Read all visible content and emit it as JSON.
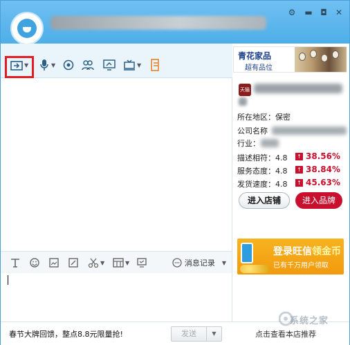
{
  "window": {
    "controls": [
      "⚙",
      "▬",
      "◘",
      "✕"
    ]
  },
  "toolbar": {
    "buttons": [
      "transfer-file",
      "voice",
      "video",
      "contacts",
      "screen-share",
      "remote-assist",
      "task"
    ]
  },
  "input_toolbar": {
    "history_label": "消息记录"
  },
  "bottom": {
    "promo": "春节大牌回馈，整点8.8元限量抢!",
    "send_label": "发送",
    "store_recommend": "点击查看本店推荐"
  },
  "right_panel": {
    "banner": {
      "brand": "青花家品",
      "sub": "超有品位"
    },
    "store_logo_text": "天猫",
    "info": {
      "region_label": "所在地区：",
      "region_value": "保密",
      "company_label": "公司名称",
      "industry_label": "行业："
    },
    "ratings": [
      {
        "label": "描述相符：4.8",
        "pct": "38.56%"
      },
      {
        "label": "服务态度：4.8",
        "pct": "38.84%"
      },
      {
        "label": "发货速度：4.8",
        "pct": "45.63%"
      }
    ],
    "enter_store": "进入店铺",
    "enter_brand": "进入品牌",
    "ww_banner": {
      "title_a": "登录旺信",
      "title_b": "领金币",
      "sub": "已有千万用户领取"
    }
  },
  "watermark": "系统之家",
  "colors": {
    "header": "#4eaee9",
    "accent_red": "#c8102e",
    "highlight": "#e31b23"
  }
}
